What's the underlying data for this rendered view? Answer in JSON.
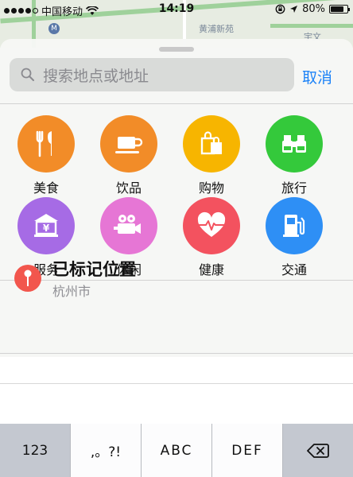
{
  "status_bar": {
    "carrier": "中国移动",
    "time": "14:19",
    "battery": "80%",
    "battery_level": 0.8
  },
  "map": {
    "labels": [
      "黄浦新苑",
      "宇文"
    ]
  },
  "search": {
    "placeholder": "搜索地点或地址",
    "cancel_label": "取消"
  },
  "categories": [
    {
      "label": "美食",
      "icon": "fork-knife-icon",
      "color": "#f28c28"
    },
    {
      "label": "饮品",
      "icon": "coffee-cup-icon",
      "color": "#f28c28"
    },
    {
      "label": "购物",
      "icon": "shopping-bags-icon",
      "color": "#f7b500"
    },
    {
      "label": "旅行",
      "icon": "binoculars-icon",
      "color": "#34c93b"
    },
    {
      "label": "服务",
      "icon": "bank-icon",
      "color": "#a66be5"
    },
    {
      "label": "休闲",
      "icon": "movie-camera-icon",
      "color": "#e676d5"
    },
    {
      "label": "健康",
      "icon": "heart-pulse-icon",
      "color": "#f3525f"
    },
    {
      "label": "交通",
      "icon": "fuel-pump-icon",
      "color": "#2e8ff5"
    }
  ],
  "marked_place": {
    "title": "已标记位置",
    "subtitle": "杭州市",
    "color": "#f2564d"
  },
  "keyboard": {
    "keys": [
      "123",
      ",。?!",
      "ABC",
      "DEF"
    ],
    "delete_icon": "backspace-icon"
  }
}
